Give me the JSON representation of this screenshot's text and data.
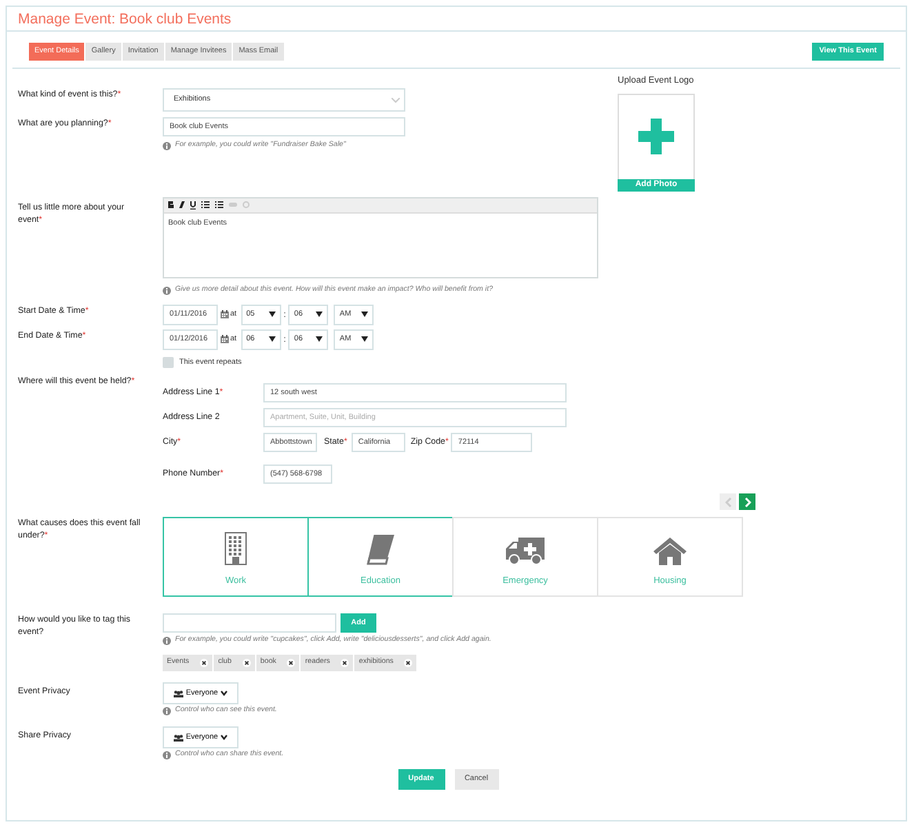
{
  "title": "Manage Event: Book club Events",
  "required_mark": "*",
  "tabs": [
    {
      "label": "Event Details",
      "selected": true
    },
    {
      "label": "Gallery",
      "selected": false
    },
    {
      "label": "Invitation",
      "selected": false
    },
    {
      "label": "Manage Invitees",
      "selected": false
    },
    {
      "label": "Mass Email",
      "selected": false
    }
  ],
  "view_button": "View This Event",
  "logo": {
    "label": "Upload Event Logo",
    "button": "Add Photo"
  },
  "event_kind": {
    "label": "What kind of event is this?",
    "required": true,
    "value": "Exhibitions"
  },
  "planning": {
    "label": "What are you planning?",
    "required": true,
    "value": "Book club Events",
    "hint": "For example, you could write \"Fundraiser Bake Sale\""
  },
  "description": {
    "label": "Tell us little more about your event",
    "required": true,
    "value": "Book club Events",
    "hint": "Give us more detail about this event. How will this event make an impact? Who will benefit from it?"
  },
  "dates": [
    {
      "label": "Start Date & Time",
      "required": true,
      "date": "01/11/2016",
      "at": "at",
      "hour": "05",
      "separator": ":",
      "minute": "06",
      "ampm": "AM"
    },
    {
      "label": "End Date & Time",
      "required": true,
      "date": "01/12/2016",
      "at": "at",
      "hour": "06",
      "separator": ":",
      "minute": "06",
      "ampm": "AM"
    }
  ],
  "repeat": {
    "label": "This event repeats",
    "checked": false
  },
  "location": {
    "label": "Where will this event be held?",
    "required": true,
    "address1": {
      "label": "Address Line 1",
      "required": true,
      "value": "12 south west"
    },
    "address2": {
      "label": "Address Line 2",
      "required": false,
      "placeholder": "Apartment, Suite, Unit, Building"
    },
    "city": {
      "label": "City",
      "required": true,
      "value": "Abbottstown"
    },
    "state": {
      "label": "State",
      "required": true,
      "value": "California"
    },
    "zip": {
      "label": "Zip Code",
      "required": true,
      "value": "72114"
    },
    "phone": {
      "label": "Phone Number",
      "required": true,
      "value": "(547) 568-6798"
    }
  },
  "pager": {
    "prev_disabled": true,
    "next_disabled": false
  },
  "causes": {
    "label": "What causes does this event fall under?",
    "required": true,
    "items": [
      {
        "label": "Work",
        "selected": true
      },
      {
        "label": "Education",
        "selected": true
      },
      {
        "label": "Emergency",
        "selected": false
      },
      {
        "label": "Housing",
        "selected": false
      }
    ]
  },
  "tags": {
    "label": "How would you like to tag this event?",
    "required": false,
    "add_button": "Add",
    "hint": "For example, you could write \"cupcakes\", click Add, write \"deliciousdesserts\", and click Add again.",
    "items": [
      "Events",
      "club",
      "book",
      "readers",
      "exhibitions"
    ]
  },
  "privacy": [
    {
      "label": "Event Privacy",
      "value": "Everyone",
      "hint": "Control who can see this event."
    },
    {
      "label": "Share Privacy",
      "value": "Everyone",
      "hint": "Control who can share this event."
    }
  ],
  "buttons": {
    "update": "Update",
    "cancel": "Cancel"
  }
}
